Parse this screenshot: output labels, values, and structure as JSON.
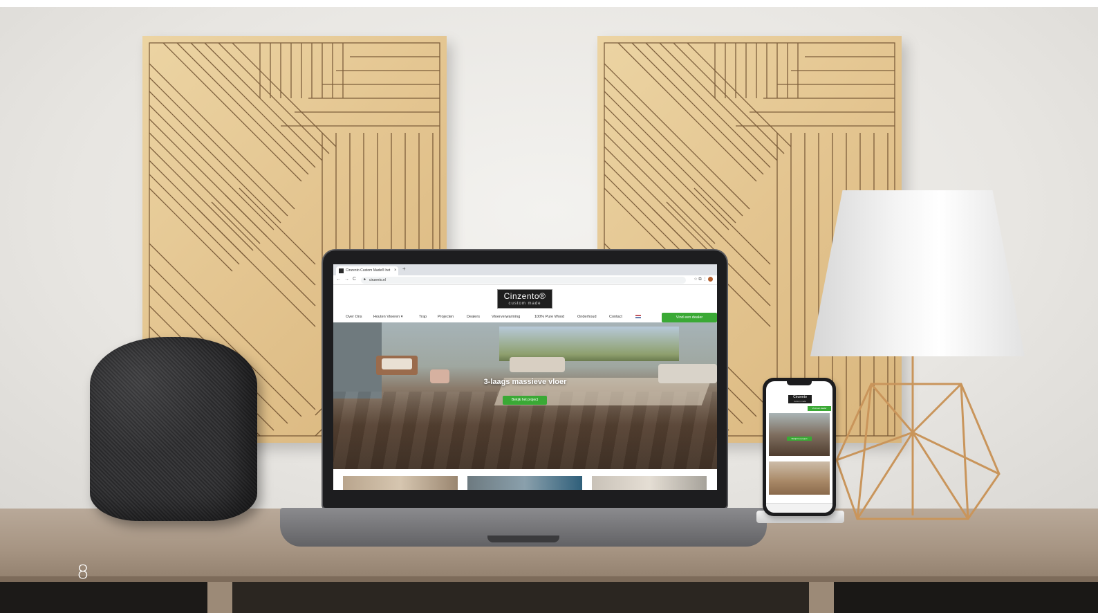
{
  "page": {
    "number": "8"
  },
  "browser": {
    "tab_title": "Cinzento Custom Made® het",
    "tab_close": "×",
    "tab_new": "+",
    "nav_back": "←",
    "nav_forward": "→",
    "nav_reload": "C",
    "url": "cinzento.nl",
    "toolbar_icons": "☆ ⧉ ⋮"
  },
  "site": {
    "logo_title": "Cinzento®",
    "logo_subtitle": "custom made",
    "nav": [
      {
        "label": "Over Ons"
      },
      {
        "label": "Houten Vloeren ▾"
      },
      {
        "label": "Trap"
      },
      {
        "label": "Projecten"
      },
      {
        "label": "Dealers"
      },
      {
        "label": "Vloerverwarming"
      },
      {
        "label": "100% Pure Wood"
      },
      {
        "label": "Onderhoud"
      },
      {
        "label": "Contact"
      }
    ],
    "cta": "Vind een dealer",
    "hero_title": "3-laags massieve vloer",
    "hero_button": "Bekijk het project"
  },
  "phone": {
    "logo_title": "Cinzento",
    "logo_subtitle": "custom made",
    "cta": "Vind een dealer",
    "hero_button": "Bekijk het project"
  },
  "colors": {
    "brand_green": "#3aa935",
    "logo_bg": "#1e1e1e"
  }
}
